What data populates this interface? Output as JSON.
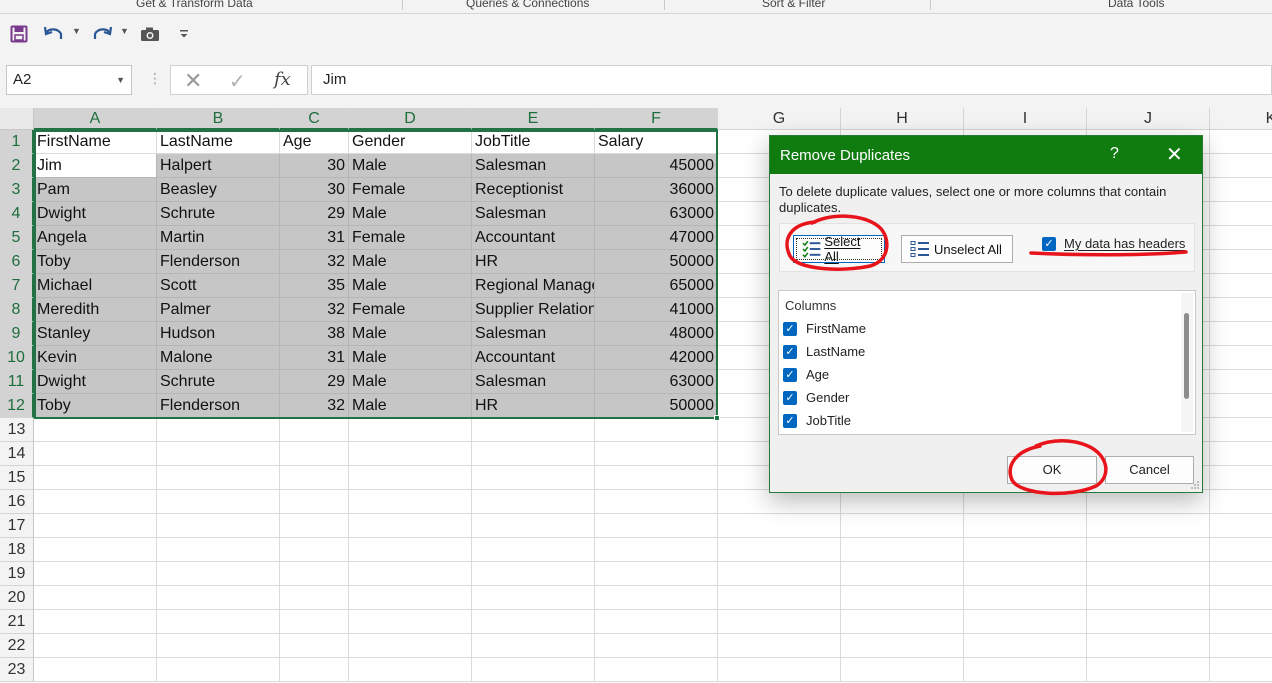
{
  "ribbon": {
    "groups": [
      "Get & Transform Data",
      "Queries & Connections",
      "Sort & Filter",
      "Data Tools"
    ]
  },
  "formula_bar": {
    "name_box": "A2",
    "value": "Jim"
  },
  "sheet": {
    "columns": [
      "A",
      "B",
      "C",
      "D",
      "E",
      "F",
      "G",
      "H",
      "I",
      "J",
      "K"
    ],
    "rows": [
      "1",
      "2",
      "3",
      "4",
      "5",
      "6",
      "7",
      "8",
      "9",
      "10",
      "11",
      "12",
      "13",
      "14",
      "15",
      "16",
      "17",
      "18",
      "19",
      "20",
      "21",
      "22",
      "23"
    ],
    "headers": [
      "FirstName",
      "LastName",
      "Age",
      "Gender",
      "JobTitle",
      "Salary"
    ],
    "data": [
      [
        "Jim",
        "Halpert",
        "30",
        "Male",
        "Salesman",
        "45000"
      ],
      [
        "Pam",
        "Beasley",
        "30",
        "Female",
        "Receptionist",
        "36000"
      ],
      [
        "Dwight",
        "Schrute",
        "29",
        "Male",
        "Salesman",
        "63000"
      ],
      [
        "Angela",
        "Martin",
        "31",
        "Female",
        "Accountant",
        "47000"
      ],
      [
        "Toby",
        "Flenderson",
        "32",
        "Male",
        "HR",
        "50000"
      ],
      [
        "Michael",
        "Scott",
        "35",
        "Male",
        "Regional Manager",
        "65000"
      ],
      [
        "Meredith",
        "Palmer",
        "32",
        "Female",
        "Supplier Relations",
        "41000"
      ],
      [
        "Stanley",
        "Hudson",
        "38",
        "Male",
        "Salesman",
        "48000"
      ],
      [
        "Kevin",
        "Malone",
        "31",
        "Male",
        "Accountant",
        "42000"
      ],
      [
        "Dwight",
        "Schrute",
        "29",
        "Male",
        "Salesman",
        "63000"
      ],
      [
        "Toby",
        "Flenderson",
        "32",
        "Male",
        "HR",
        "50000"
      ]
    ]
  },
  "dialog": {
    "title": "Remove Duplicates",
    "help": "?",
    "close": "✕",
    "description": "To delete duplicate values, select one or more columns that contain duplicates.",
    "select_all": "Select All",
    "unselect_all": "Unselect All",
    "has_headers": "My data has headers",
    "columns_title": "Columns",
    "columns": [
      "FirstName",
      "LastName",
      "Age",
      "Gender",
      "JobTitle"
    ],
    "ok": "OK",
    "cancel": "Cancel"
  },
  "colors": {
    "accent": "#107c10",
    "selection": "#217346",
    "checkbox": "#0067c0",
    "annotation": "#e8141b"
  }
}
